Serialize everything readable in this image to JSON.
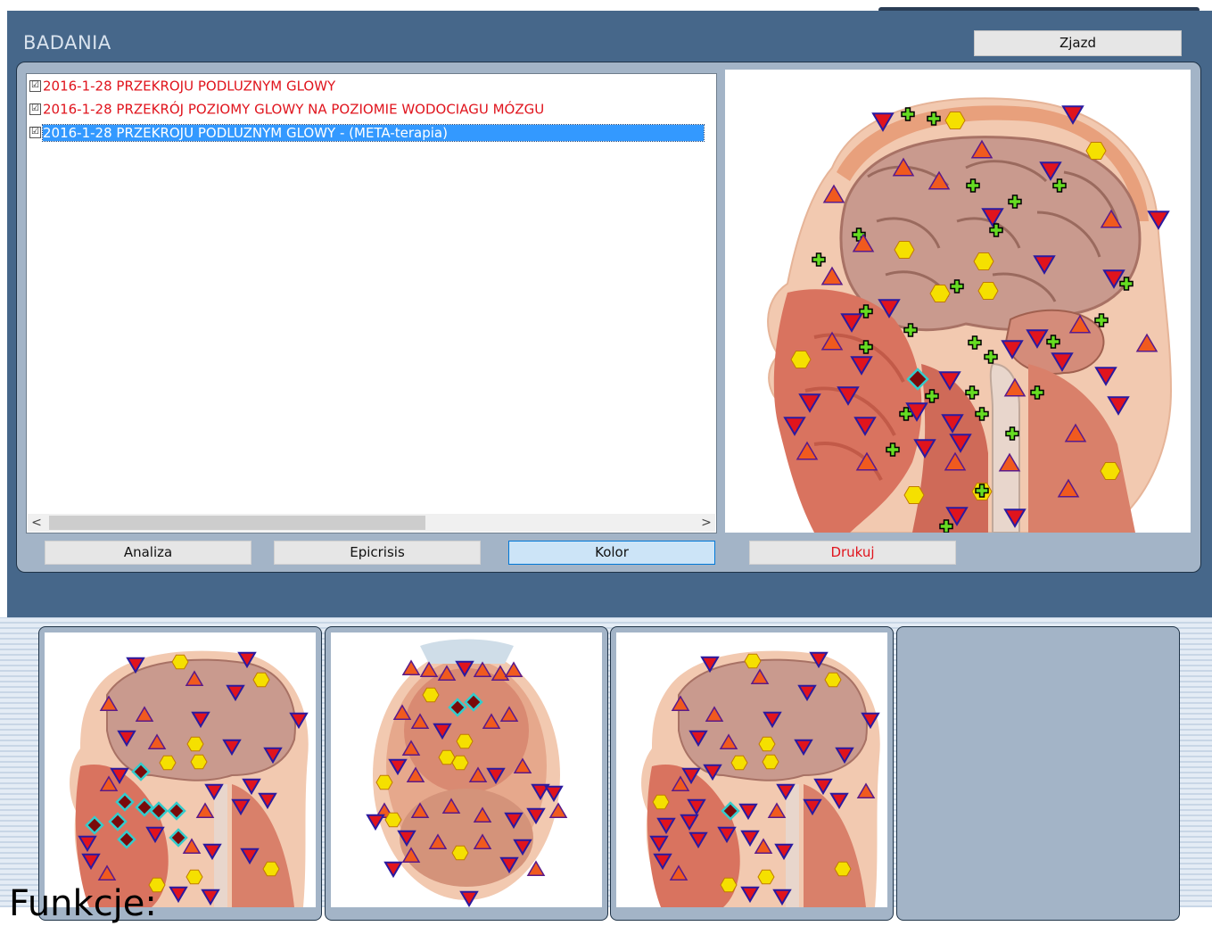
{
  "section": {
    "title": "BADANIA"
  },
  "toolbar": {
    "exit_label": "Zjazd"
  },
  "studies": {
    "items": [
      {
        "label": "2016-1-28 PRZEKROJU PODLUZNYM GLOWY",
        "checked": true,
        "color": "#e0141d"
      },
      {
        "label": "2016-1-28 PRZEKRÓJ POZIOMY GLOWY NA POZIOMIE WODOCIAGU MÓZGU",
        "checked": true,
        "color": "#e0141d"
      },
      {
        "label": "2016-1-28 PRZEKROJU PODLUZNYM GLOWY - (META-terapia)",
        "checked": true,
        "selected": true
      }
    ],
    "checkbox_glyph": "☑"
  },
  "scroll": {
    "left_arrow": "<",
    "right_arrow": ">"
  },
  "actions": {
    "analyze_label": "Analiza",
    "epicrisis_label": "Epicrisis",
    "color_label": "Kolor",
    "print_label": "Drukuj"
  },
  "footer": {
    "functions_label": "Funkcje:"
  },
  "marker_colors": {
    "triangle_down": "#e0141d",
    "triangle_up": "#f05a1e",
    "hexagon": "#f5e000",
    "plus": "#66dd22",
    "diamond": "#7a0a0a",
    "diamond_outline": "#33cccc"
  },
  "thumbnails": [
    {
      "view": "sagittal"
    },
    {
      "view": "axial"
    },
    {
      "view": "sagittal"
    },
    {
      "view": "empty"
    }
  ]
}
